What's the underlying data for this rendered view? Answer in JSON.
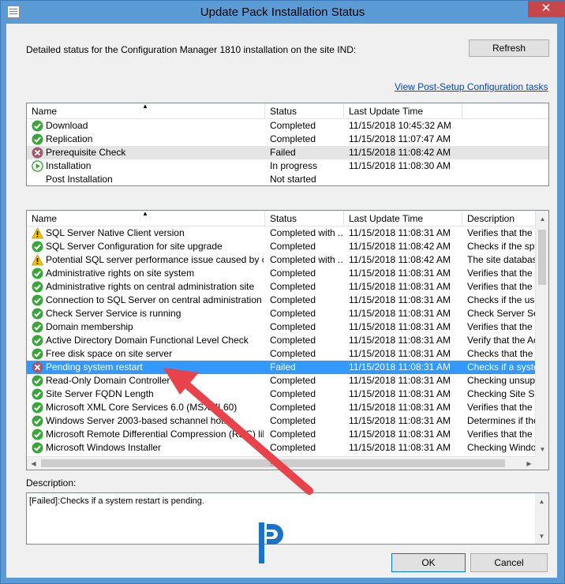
{
  "window": {
    "title": "Update Pack Installation Status",
    "close_glyph": "✕"
  },
  "status_text": "Detailed status for the Configuration Manager 1810 installation on the site IND:",
  "refresh_label": "Refresh",
  "post_setup_link": "View Post-Setup Configuration tasks",
  "top_list": {
    "columns": [
      "Name",
      "Status",
      "Last Update Time"
    ],
    "rows": [
      {
        "icon": "check",
        "name": "Download",
        "status": "Completed",
        "time": "11/15/2018 10:45:32 AM"
      },
      {
        "icon": "check",
        "name": "Replication",
        "status": "Completed",
        "time": "11/15/2018 11:07:47 AM"
      },
      {
        "icon": "error",
        "name": "Prerequisite Check",
        "status": "Failed",
        "time": "11/15/2018 11:08:42 AM"
      },
      {
        "icon": "play",
        "name": "Installation",
        "status": "In progress",
        "time": "11/15/2018 11:08:30 AM"
      },
      {
        "icon": "none",
        "name": "Post Installation",
        "status": "Not started",
        "time": ""
      }
    ]
  },
  "bottom_list": {
    "columns": [
      "Name",
      "Status",
      "Last Update Time",
      "Description"
    ],
    "rows": [
      {
        "icon": "warning",
        "name": "SQL Server Native Client version",
        "status": "Completed with ...",
        "time": "11/15/2018 11:08:31 AM",
        "desc": "Verifies that the ve"
      },
      {
        "icon": "check",
        "name": "SQL Server Configuration for site upgrade",
        "status": "Completed",
        "time": "11/15/2018 11:08:42 AM",
        "desc": "Checks if the spec"
      },
      {
        "icon": "warning",
        "name": "Potential SQL server performance issue caused by chan...",
        "status": "Completed with ...",
        "time": "11/15/2018 11:08:42 AM",
        "desc": "The site database"
      },
      {
        "icon": "check",
        "name": "Administrative rights on site system",
        "status": "Completed",
        "time": "11/15/2018 11:08:31 AM",
        "desc": "Verifies that the log"
      },
      {
        "icon": "check",
        "name": "Administrative rights on central administration site",
        "status": "Completed",
        "time": "11/15/2018 11:08:31 AM",
        "desc": "Verifies that the us"
      },
      {
        "icon": "check",
        "name": "Connection to SQL Server on central administration site",
        "status": "Completed",
        "time": "11/15/2018 11:08:31 AM",
        "desc": "Checks if the user"
      },
      {
        "icon": "check",
        "name": "Check Server Service is running",
        "status": "Completed",
        "time": "11/15/2018 11:08:31 AM",
        "desc": "Check Server Serv"
      },
      {
        "icon": "check",
        "name": "Domain membership",
        "status": "Completed",
        "time": "11/15/2018 11:08:31 AM",
        "desc": "Verifies that the co"
      },
      {
        "icon": "check",
        "name": "Active Directory Domain Functional Level Check",
        "status": "Completed",
        "time": "11/15/2018 11:08:31 AM",
        "desc": "Verify that the Activ"
      },
      {
        "icon": "check",
        "name": "Free disk space on site server",
        "status": "Completed",
        "time": "11/15/2018 11:08:31 AM",
        "desc": "Checks that the sit"
      },
      {
        "icon": "error",
        "name": "Pending system restart",
        "status": "Failed",
        "time": "11/15/2018 11:08:31 AM",
        "desc": "Checks if a system"
      },
      {
        "icon": "check",
        "name": "Read-Only Domain Controller",
        "status": "Completed",
        "time": "11/15/2018 11:08:31 AM",
        "desc": "Checking unsuppo"
      },
      {
        "icon": "check",
        "name": "Site Server FQDN Length",
        "status": "Completed",
        "time": "11/15/2018 11:08:31 AM",
        "desc": "Checking Site Serv"
      },
      {
        "icon": "check",
        "name": "Microsoft XML Core Services 6.0 (MSXML60)",
        "status": "Completed",
        "time": "11/15/2018 11:08:31 AM",
        "desc": "Verifies that the Mi"
      },
      {
        "icon": "check",
        "name": "Windows Server 2003-based schannel hotfix",
        "status": "Completed",
        "time": "11/15/2018 11:08:31 AM",
        "desc": "Determines if the W"
      },
      {
        "icon": "check",
        "name": "Microsoft Remote Differential Compression (RDC) library r...",
        "status": "Completed",
        "time": "11/15/2018 11:08:31 AM",
        "desc": "Verifies that the Mi"
      },
      {
        "icon": "check",
        "name": "Microsoft Windows Installer",
        "status": "Completed",
        "time": "11/15/2018 11:08:31 AM",
        "desc": "Checking Window"
      }
    ],
    "selected_index": 10
  },
  "description_label": "Description:",
  "description_text": "[Failed]:Checks if a system restart is pending.",
  "ok_label": "OK",
  "cancel_label": "Cancel",
  "colors": {
    "titlebar": "#5b9bd5",
    "close": "#c7464a",
    "selection": "#3399ff",
    "annotation_arrow": "#e8424a",
    "check": "#3aa53a",
    "error": "#a05a6a",
    "warning": "#f2c400"
  }
}
